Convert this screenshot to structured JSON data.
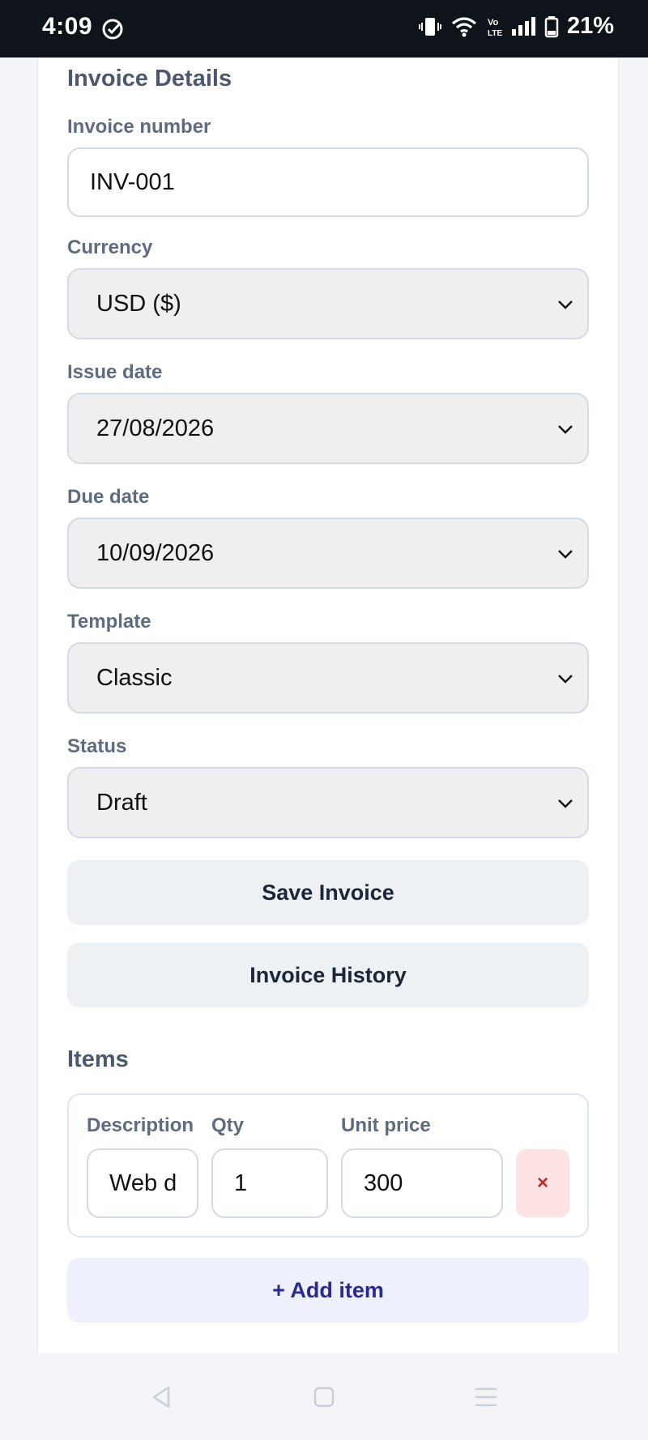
{
  "status_bar": {
    "time": "4:09",
    "battery": "21%",
    "icons": [
      "check-circle-icon",
      "vibrate-icon",
      "wifi-icon",
      "volte-icon",
      "signal-icon",
      "battery-icon"
    ]
  },
  "invoice_details": {
    "title": "Invoice Details",
    "invoice_number_label": "Invoice number",
    "invoice_number_value": "INV-001",
    "currency_label": "Currency",
    "currency_value": "USD ($)",
    "issue_date_label": "Issue date",
    "issue_date_value": "27/08/2026",
    "due_date_label": "Due date",
    "due_date_value": "10/09/2026",
    "template_label": "Template",
    "template_value": "Classic",
    "status_label": "Status",
    "status_value": "Draft",
    "save_label": "Save Invoice",
    "history_label": "Invoice History"
  },
  "items": {
    "title": "Items",
    "columns": [
      "Description",
      "Qty",
      "Unit price"
    ],
    "rows": [
      {
        "description": "Web d",
        "qty": "1",
        "unit_price": "300",
        "remove_label": "×"
      }
    ],
    "add_label": "+ Add item"
  },
  "colors": {
    "accent": "#2a2a8f",
    "danger": "#c62828",
    "danger_bg": "#fde3e3"
  }
}
